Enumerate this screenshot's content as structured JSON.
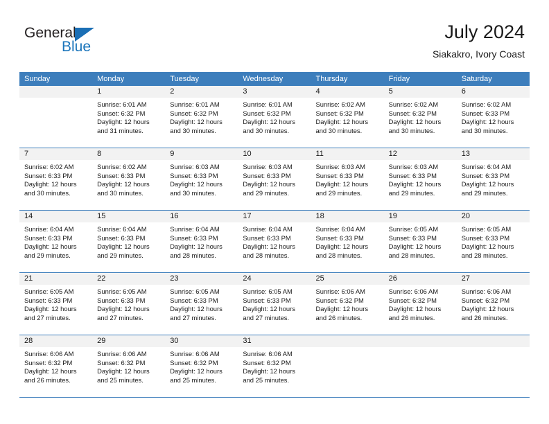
{
  "logo": {
    "word_top": "General",
    "word_bottom": "Blue",
    "brand_color": "#1B75BB"
  },
  "header": {
    "title": "July 2024",
    "subtitle": "Siakakro, Ivory Coast"
  },
  "theme": {
    "header_bg": "#3D7EBC",
    "daynum_bg": "#F2F2F2",
    "text": "#1A1A1A"
  },
  "calendar": {
    "weekday_headers": [
      "Sunday",
      "Monday",
      "Tuesday",
      "Wednesday",
      "Thursday",
      "Friday",
      "Saturday"
    ],
    "weeks": [
      [
        {
          "day": "",
          "sunrise": "",
          "sunset": "",
          "daylight1": "",
          "daylight2": ""
        },
        {
          "day": "1",
          "sunrise": "Sunrise: 6:01 AM",
          "sunset": "Sunset: 6:32 PM",
          "daylight1": "Daylight: 12 hours",
          "daylight2": "and 31 minutes."
        },
        {
          "day": "2",
          "sunrise": "Sunrise: 6:01 AM",
          "sunset": "Sunset: 6:32 PM",
          "daylight1": "Daylight: 12 hours",
          "daylight2": "and 30 minutes."
        },
        {
          "day": "3",
          "sunrise": "Sunrise: 6:01 AM",
          "sunset": "Sunset: 6:32 PM",
          "daylight1": "Daylight: 12 hours",
          "daylight2": "and 30 minutes."
        },
        {
          "day": "4",
          "sunrise": "Sunrise: 6:02 AM",
          "sunset": "Sunset: 6:32 PM",
          "daylight1": "Daylight: 12 hours",
          "daylight2": "and 30 minutes."
        },
        {
          "day": "5",
          "sunrise": "Sunrise: 6:02 AM",
          "sunset": "Sunset: 6:32 PM",
          "daylight1": "Daylight: 12 hours",
          "daylight2": "and 30 minutes."
        },
        {
          "day": "6",
          "sunrise": "Sunrise: 6:02 AM",
          "sunset": "Sunset: 6:33 PM",
          "daylight1": "Daylight: 12 hours",
          "daylight2": "and 30 minutes."
        }
      ],
      [
        {
          "day": "7",
          "sunrise": "Sunrise: 6:02 AM",
          "sunset": "Sunset: 6:33 PM",
          "daylight1": "Daylight: 12 hours",
          "daylight2": "and 30 minutes."
        },
        {
          "day": "8",
          "sunrise": "Sunrise: 6:02 AM",
          "sunset": "Sunset: 6:33 PM",
          "daylight1": "Daylight: 12 hours",
          "daylight2": "and 30 minutes."
        },
        {
          "day": "9",
          "sunrise": "Sunrise: 6:03 AM",
          "sunset": "Sunset: 6:33 PM",
          "daylight1": "Daylight: 12 hours",
          "daylight2": "and 30 minutes."
        },
        {
          "day": "10",
          "sunrise": "Sunrise: 6:03 AM",
          "sunset": "Sunset: 6:33 PM",
          "daylight1": "Daylight: 12 hours",
          "daylight2": "and 29 minutes."
        },
        {
          "day": "11",
          "sunrise": "Sunrise: 6:03 AM",
          "sunset": "Sunset: 6:33 PM",
          "daylight1": "Daylight: 12 hours",
          "daylight2": "and 29 minutes."
        },
        {
          "day": "12",
          "sunrise": "Sunrise: 6:03 AM",
          "sunset": "Sunset: 6:33 PM",
          "daylight1": "Daylight: 12 hours",
          "daylight2": "and 29 minutes."
        },
        {
          "day": "13",
          "sunrise": "Sunrise: 6:04 AM",
          "sunset": "Sunset: 6:33 PM",
          "daylight1": "Daylight: 12 hours",
          "daylight2": "and 29 minutes."
        }
      ],
      [
        {
          "day": "14",
          "sunrise": "Sunrise: 6:04 AM",
          "sunset": "Sunset: 6:33 PM",
          "daylight1": "Daylight: 12 hours",
          "daylight2": "and 29 minutes."
        },
        {
          "day": "15",
          "sunrise": "Sunrise: 6:04 AM",
          "sunset": "Sunset: 6:33 PM",
          "daylight1": "Daylight: 12 hours",
          "daylight2": "and 29 minutes."
        },
        {
          "day": "16",
          "sunrise": "Sunrise: 6:04 AM",
          "sunset": "Sunset: 6:33 PM",
          "daylight1": "Daylight: 12 hours",
          "daylight2": "and 28 minutes."
        },
        {
          "day": "17",
          "sunrise": "Sunrise: 6:04 AM",
          "sunset": "Sunset: 6:33 PM",
          "daylight1": "Daylight: 12 hours",
          "daylight2": "and 28 minutes."
        },
        {
          "day": "18",
          "sunrise": "Sunrise: 6:04 AM",
          "sunset": "Sunset: 6:33 PM",
          "daylight1": "Daylight: 12 hours",
          "daylight2": "and 28 minutes."
        },
        {
          "day": "19",
          "sunrise": "Sunrise: 6:05 AM",
          "sunset": "Sunset: 6:33 PM",
          "daylight1": "Daylight: 12 hours",
          "daylight2": "and 28 minutes."
        },
        {
          "day": "20",
          "sunrise": "Sunrise: 6:05 AM",
          "sunset": "Sunset: 6:33 PM",
          "daylight1": "Daylight: 12 hours",
          "daylight2": "and 28 minutes."
        }
      ],
      [
        {
          "day": "21",
          "sunrise": "Sunrise: 6:05 AM",
          "sunset": "Sunset: 6:33 PM",
          "daylight1": "Daylight: 12 hours",
          "daylight2": "and 27 minutes."
        },
        {
          "day": "22",
          "sunrise": "Sunrise: 6:05 AM",
          "sunset": "Sunset: 6:33 PM",
          "daylight1": "Daylight: 12 hours",
          "daylight2": "and 27 minutes."
        },
        {
          "day": "23",
          "sunrise": "Sunrise: 6:05 AM",
          "sunset": "Sunset: 6:33 PM",
          "daylight1": "Daylight: 12 hours",
          "daylight2": "and 27 minutes."
        },
        {
          "day": "24",
          "sunrise": "Sunrise: 6:05 AM",
          "sunset": "Sunset: 6:33 PM",
          "daylight1": "Daylight: 12 hours",
          "daylight2": "and 27 minutes."
        },
        {
          "day": "25",
          "sunrise": "Sunrise: 6:06 AM",
          "sunset": "Sunset: 6:32 PM",
          "daylight1": "Daylight: 12 hours",
          "daylight2": "and 26 minutes."
        },
        {
          "day": "26",
          "sunrise": "Sunrise: 6:06 AM",
          "sunset": "Sunset: 6:32 PM",
          "daylight1": "Daylight: 12 hours",
          "daylight2": "and 26 minutes."
        },
        {
          "day": "27",
          "sunrise": "Sunrise: 6:06 AM",
          "sunset": "Sunset: 6:32 PM",
          "daylight1": "Daylight: 12 hours",
          "daylight2": "and 26 minutes."
        }
      ],
      [
        {
          "day": "28",
          "sunrise": "Sunrise: 6:06 AM",
          "sunset": "Sunset: 6:32 PM",
          "daylight1": "Daylight: 12 hours",
          "daylight2": "and 26 minutes."
        },
        {
          "day": "29",
          "sunrise": "Sunrise: 6:06 AM",
          "sunset": "Sunset: 6:32 PM",
          "daylight1": "Daylight: 12 hours",
          "daylight2": "and 25 minutes."
        },
        {
          "day": "30",
          "sunrise": "Sunrise: 6:06 AM",
          "sunset": "Sunset: 6:32 PM",
          "daylight1": "Daylight: 12 hours",
          "daylight2": "and 25 minutes."
        },
        {
          "day": "31",
          "sunrise": "Sunrise: 6:06 AM",
          "sunset": "Sunset: 6:32 PM",
          "daylight1": "Daylight: 12 hours",
          "daylight2": "and 25 minutes."
        },
        {
          "day": "",
          "sunrise": "",
          "sunset": "",
          "daylight1": "",
          "daylight2": ""
        },
        {
          "day": "",
          "sunrise": "",
          "sunset": "",
          "daylight1": "",
          "daylight2": ""
        },
        {
          "day": "",
          "sunrise": "",
          "sunset": "",
          "daylight1": "",
          "daylight2": ""
        }
      ]
    ]
  }
}
